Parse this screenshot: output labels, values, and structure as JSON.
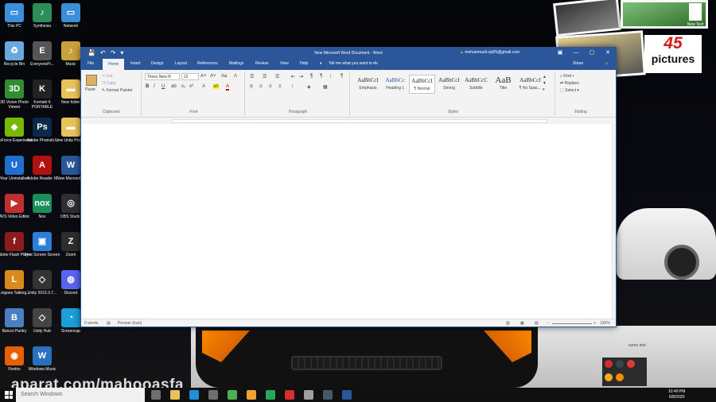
{
  "desktop": {
    "overlay_badge": {
      "number": "45",
      "text": "pictures"
    },
    "new_text": "New Text",
    "faint_text": "some text",
    "icons_col1": [
      {
        "label": "This PC",
        "color": "#3a8fd8",
        "glyph": "▭"
      },
      {
        "label": "Recycle Bin",
        "color": "#6aa9de",
        "glyph": "♻"
      },
      {
        "label": "3D Vision Photo Viewer",
        "color": "#2f8f2f",
        "glyph": "3D"
      },
      {
        "label": "GeForce Experience",
        "color": "#76b900",
        "glyph": "◆"
      },
      {
        "label": "Your Uninstaller!",
        "color": "#1f6fcf",
        "glyph": "U"
      },
      {
        "label": "AVS Video Editor",
        "color": "#c03030",
        "glyph": "▶"
      },
      {
        "label": "Adobe Flash Player",
        "color": "#8e1b1b",
        "glyph": "f"
      },
      {
        "label": "Lingoes Talking...",
        "color": "#d88a1a",
        "glyph": "L"
      },
      {
        "label": "Buncci Pantry",
        "color": "#4a7fc0",
        "glyph": "B"
      },
      {
        "label": "Firefox",
        "color": "#e66000",
        "glyph": "◉"
      }
    ],
    "icons_col2": [
      {
        "label": "Synthesia",
        "color": "#2c8f5a",
        "glyph": "♪"
      },
      {
        "label": "EveryonePi...",
        "color": "#555555",
        "glyph": "E"
      },
      {
        "label": "Kontakt 6 PORTABLE",
        "color": "#222222",
        "glyph": "K"
      },
      {
        "label": "Adobe Photosh...",
        "color": "#0b2a4a",
        "glyph": "Ps"
      },
      {
        "label": "Adobe Reader XI",
        "color": "#b31010",
        "glyph": "A"
      },
      {
        "label": "Nox",
        "color": "#1a8f5a",
        "glyph": "nox"
      },
      {
        "label": "Free Screen Screen",
        "color": "#2b7fd8",
        "glyph": "▣"
      },
      {
        "label": "Unity 2019.3.7...",
        "color": "#333333",
        "glyph": "◇"
      },
      {
        "label": "Unity Hub",
        "color": "#444444",
        "glyph": "◇"
      },
      {
        "label": "Windows Music",
        "color": "#2b6fc0",
        "glyph": "W"
      }
    ],
    "icons_col3": [
      {
        "label": "Network",
        "color": "#3a8fd8",
        "glyph": "▭"
      },
      {
        "label": "Music",
        "color": "#c9a13a",
        "glyph": "♪"
      },
      {
        "label": "New folder",
        "color": "#e8c35a",
        "glyph": "▬"
      },
      {
        "label": "New Unity Project",
        "color": "#e8c35a",
        "glyph": "▬"
      },
      {
        "label": "New Microsoft...",
        "color": "#2b579a",
        "glyph": "W"
      },
      {
        "label": "OBS Studio",
        "color": "#302e31",
        "glyph": "◎"
      },
      {
        "label": "Zoom",
        "color": "#2d2d2d",
        "glyph": "Z"
      },
      {
        "label": "Discord",
        "color": "#5865f2",
        "glyph": "◍"
      },
      {
        "label": "Screencap",
        "color": "#1aa0d8",
        "glyph": "◔"
      }
    ],
    "watermark": "aparat.com/mahooasfa"
  },
  "word": {
    "title": "New Microsoft Word Document - Word",
    "account": "mohammadi.sjd25@gmail.com",
    "quick_access": [
      "💾",
      "↶",
      "↷",
      "▾"
    ],
    "window_buttons": [
      "▣",
      "—",
      "▢",
      "✕"
    ],
    "tabs": [
      "File",
      "Home",
      "Insert",
      "Design",
      "Layout",
      "References",
      "Mailings",
      "Review",
      "View",
      "Help"
    ],
    "tell_me": "Tell me what you want to do",
    "share": "Share",
    "clipboard": {
      "paste": "Paste",
      "cut": "Cut",
      "copy": "Copy",
      "format_painter": "Format Painter",
      "label": "Clipboard"
    },
    "font": {
      "name": "Times New R",
      "size": "12",
      "label": "Font",
      "bold": "B",
      "italic": "I",
      "underline": "U"
    },
    "paragraph": {
      "label": "Paragraph"
    },
    "styles": {
      "label": "Styles",
      "items": [
        {
          "preview": "AaBbCcI",
          "name": "Emphasis"
        },
        {
          "preview": "AaBbCc",
          "name": "Heading 1"
        },
        {
          "preview": "AaBbCcI",
          "name": "¶ Normal"
        },
        {
          "preview": "AaBbCcI",
          "name": "Strong"
        },
        {
          "preview": "AaBbCcC",
          "name": "Subtitle"
        },
        {
          "preview": "AaB",
          "name": "Title"
        },
        {
          "preview": "AaBbCcI",
          "name": "¶ No Spac..."
        }
      ]
    },
    "editing": {
      "find": "Find",
      "replace": "Replace",
      "select": "Select",
      "label": "Editing"
    },
    "status": {
      "words": "0 words",
      "language": "Persian (Iran)",
      "zoom": "130%"
    }
  },
  "taskbar": {
    "search_placeholder": "Search Windows",
    "time": "10:49 PM",
    "date": "6/8/2020",
    "pinned": [
      {
        "name": "task-view",
        "color": "#6f6f6f"
      },
      {
        "name": "file-explorer",
        "color": "#e8c35a"
      },
      {
        "name": "edge",
        "color": "#1f8fd8"
      },
      {
        "name": "store",
        "color": "#6f6f6f"
      },
      {
        "name": "chrome",
        "color": "#4caf50"
      },
      {
        "name": "app-yellow",
        "color": "#f0a030"
      },
      {
        "name": "app-green",
        "color": "#2aa85a"
      },
      {
        "name": "app-red",
        "color": "#d32f2f"
      },
      {
        "name": "app-gray",
        "color": "#9e9e9e"
      },
      {
        "name": "terminal",
        "color": "#455a64"
      },
      {
        "name": "word",
        "color": "#2b579a"
      }
    ]
  }
}
